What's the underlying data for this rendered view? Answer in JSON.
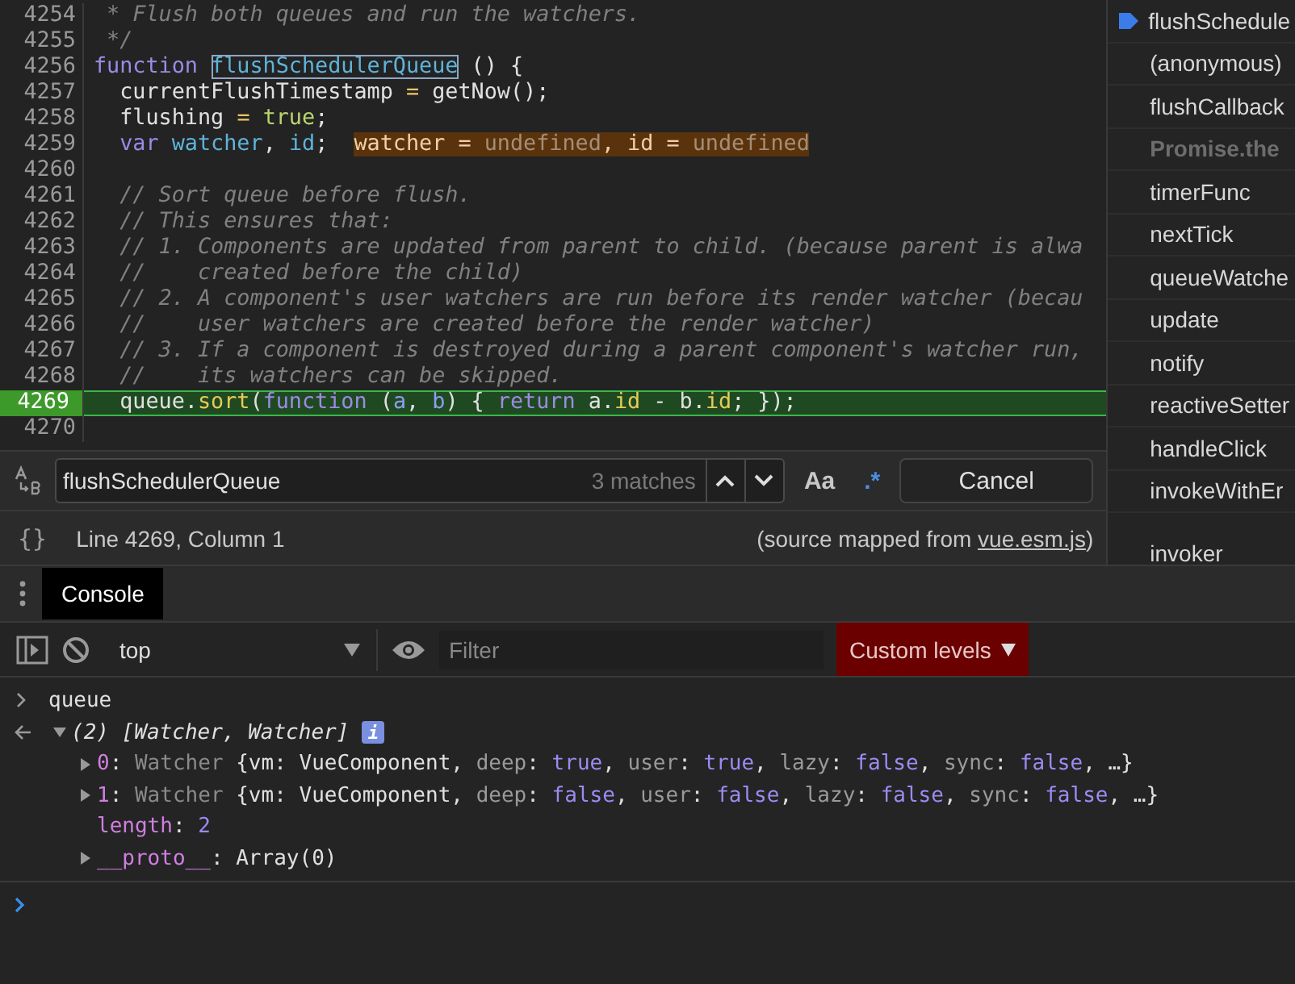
{
  "editor": {
    "lines": [
      {
        "num": "4254",
        "current": false,
        "tokens": [
          {
            "kind": "comment",
            "text": " * Flush both queues and run the watchers."
          }
        ]
      },
      {
        "num": "4255",
        "current": false,
        "tokens": [
          {
            "kind": "comment",
            "text": " */"
          }
        ]
      },
      {
        "num": "4256",
        "current": false,
        "tokens": [
          {
            "kind": "kw",
            "text": "function "
          },
          {
            "kind": "match",
            "text": "flushSchedulerQueue"
          },
          {
            "kind": "plain",
            "text": " () {"
          }
        ]
      },
      {
        "num": "4257",
        "current": false,
        "tokens": [
          {
            "kind": "plain",
            "text": "  currentFlushTimestamp "
          },
          {
            "kind": "op",
            "text": "="
          },
          {
            "kind": "plain",
            "text": " getNow();"
          }
        ]
      },
      {
        "num": "4258",
        "current": false,
        "tokens": [
          {
            "kind": "plain",
            "text": "  flushing "
          },
          {
            "kind": "op",
            "text": "= "
          },
          {
            "kind": "bool",
            "text": "true"
          },
          {
            "kind": "plain",
            "text": ";"
          }
        ]
      },
      {
        "num": "4259",
        "current": false,
        "tokens": [
          {
            "kind": "kw",
            "text": "  var "
          },
          {
            "kind": "var",
            "text": "watcher"
          },
          {
            "kind": "plain",
            "text": ", "
          },
          {
            "kind": "var",
            "text": "id"
          },
          {
            "kind": "plain",
            "text": ";  "
          },
          {
            "kind": "inline_key",
            "text": "watcher = "
          },
          {
            "kind": "inline_val",
            "text": "undefined"
          },
          {
            "kind": "inline_key",
            "text": ", id = "
          },
          {
            "kind": "inline_val",
            "text": "undefined"
          }
        ]
      },
      {
        "num": "4260",
        "current": false
      },
      {
        "num": "4261",
        "current": false,
        "tokens": [
          {
            "kind": "comment",
            "text": "  // Sort queue before flush."
          }
        ]
      },
      {
        "num": "4262",
        "current": false,
        "tokens": [
          {
            "kind": "comment",
            "text": "  // This ensures that:"
          }
        ]
      },
      {
        "num": "4263",
        "current": false,
        "tokens": [
          {
            "kind": "comment",
            "text": "  // 1. Components are updated from parent to child. (because parent is alwa"
          }
        ]
      },
      {
        "num": "4264",
        "current": false,
        "tokens": [
          {
            "kind": "comment",
            "text": "  //    created before the child)"
          }
        ]
      },
      {
        "num": "4265",
        "current": false,
        "tokens": [
          {
            "kind": "comment",
            "text": "  // 2. A component's user watchers are run before its render watcher (becau"
          }
        ]
      },
      {
        "num": "4266",
        "current": false,
        "tokens": [
          {
            "kind": "comment",
            "text": "  //    user watchers are created before the render watcher)"
          }
        ]
      },
      {
        "num": "4267",
        "current": false,
        "tokens": [
          {
            "kind": "comment",
            "text": "  // 3. If a component is destroyed during a parent component's watcher run,"
          }
        ]
      },
      {
        "num": "4268",
        "current": false,
        "tokens": [
          {
            "kind": "comment",
            "text": "  //    its watchers can be skipped."
          }
        ]
      },
      {
        "num": "4269",
        "current": true,
        "tokens": [
          {
            "kind": "plain",
            "text": "  queue."
          },
          {
            "kind": "prop",
            "text": "sort"
          },
          {
            "kind": "plain",
            "text": "("
          },
          {
            "kind": "kw",
            "text": "function"
          },
          {
            "kind": "plain",
            "text": " ("
          },
          {
            "kind": "param",
            "text": "a"
          },
          {
            "kind": "plain",
            "text": ", "
          },
          {
            "kind": "param",
            "text": "b"
          },
          {
            "kind": "plain",
            "text": ") { "
          },
          {
            "kind": "kw",
            "text": "return"
          },
          {
            "kind": "plain",
            "text": " a."
          },
          {
            "kind": "prop",
            "text": "id"
          },
          {
            "kind": "plain",
            "text": " - b."
          },
          {
            "kind": "prop",
            "text": "id"
          },
          {
            "kind": "plain",
            "text": "; });"
          }
        ]
      },
      {
        "num": "4270",
        "current": false
      }
    ]
  },
  "call_stack": [
    {
      "label": "flushSchedule",
      "kind": "frame",
      "selected": true
    },
    {
      "label": "(anonymous)",
      "kind": "frame",
      "selected": false
    },
    {
      "label": "flushCallback",
      "kind": "frame",
      "selected": false
    },
    {
      "label": "Promise.the",
      "kind": "async",
      "selected": false
    },
    {
      "label": "timerFunc",
      "kind": "frame",
      "selected": false
    },
    {
      "label": "nextTick",
      "kind": "frame",
      "selected": false
    },
    {
      "label": "queueWatche",
      "kind": "frame",
      "selected": false
    },
    {
      "label": "update",
      "kind": "frame",
      "selected": false
    },
    {
      "label": "notify",
      "kind": "frame",
      "selected": false
    },
    {
      "label": "reactiveSetter",
      "kind": "frame",
      "selected": false
    },
    {
      "label": "handleClick",
      "kind": "frame",
      "selected": false
    },
    {
      "label": "invokeWithEr",
      "kind": "frame",
      "selected": false
    },
    {
      "label": "invoker",
      "kind": "frame",
      "selected": false
    }
  ],
  "search": {
    "value": "flushSchedulerQueue",
    "matches": "3 matches",
    "case_button": "Aa",
    "regex_button": ".*",
    "cancel": "Cancel"
  },
  "status": {
    "format_glyph": "{}",
    "position": "Line 4269, Column 1",
    "source_prefix": "(source mapped from ",
    "source_link": "vue.esm.js",
    "source_suffix": ")"
  },
  "drawer_tabs": [
    {
      "label": "Console",
      "selected": true
    }
  ],
  "console_toolbar": {
    "context": "top",
    "filter_placeholder": "Filter",
    "levels": "Custom levels"
  },
  "console": [
    {
      "kind": "input",
      "tokens": [
        {
          "kind": "plain",
          "text": "queue"
        }
      ]
    },
    {
      "kind": "result",
      "expanded": true,
      "tokens": [
        {
          "kind": "summary",
          "text": "(2) [Watcher, Watcher]"
        }
      ],
      "badge": "i",
      "children": [
        {
          "expandable": true,
          "tokens": [
            {
              "kind": "key",
              "text": "0"
            },
            {
              "kind": "plain",
              "text": ": "
            },
            {
              "kind": "cls",
              "text": "Watcher"
            },
            {
              "kind": "plain",
              "text": " {vm: VueComponent, "
            },
            {
              "kind": "pkey",
              "text": "deep"
            },
            {
              "kind": "plain",
              "text": ": "
            },
            {
              "kind": "bool",
              "text": "true"
            },
            {
              "kind": "plain",
              "text": ", "
            },
            {
              "kind": "pkey",
              "text": "user"
            },
            {
              "kind": "plain",
              "text": ": "
            },
            {
              "kind": "bool",
              "text": "true"
            },
            {
              "kind": "plain",
              "text": ", "
            },
            {
              "kind": "pkey",
              "text": "lazy"
            },
            {
              "kind": "plain",
              "text": ": "
            },
            {
              "kind": "bool",
              "text": "false"
            },
            {
              "kind": "plain",
              "text": ", "
            },
            {
              "kind": "pkey",
              "text": "sync"
            },
            {
              "kind": "plain",
              "text": ": "
            },
            {
              "kind": "bool",
              "text": "false"
            },
            {
              "kind": "plain",
              "text": ", …}"
            }
          ]
        },
        {
          "expandable": true,
          "tokens": [
            {
              "kind": "key",
              "text": "1"
            },
            {
              "kind": "plain",
              "text": ": "
            },
            {
              "kind": "cls",
              "text": "Watcher"
            },
            {
              "kind": "plain",
              "text": " {vm: VueComponent, "
            },
            {
              "kind": "pkey",
              "text": "deep"
            },
            {
              "kind": "plain",
              "text": ": "
            },
            {
              "kind": "bool",
              "text": "false"
            },
            {
              "kind": "plain",
              "text": ", "
            },
            {
              "kind": "pkey",
              "text": "user"
            },
            {
              "kind": "plain",
              "text": ": "
            },
            {
              "kind": "bool",
              "text": "false"
            },
            {
              "kind": "plain",
              "text": ", "
            },
            {
              "kind": "pkey",
              "text": "lazy"
            },
            {
              "kind": "plain",
              "text": ": "
            },
            {
              "kind": "bool",
              "text": "false"
            },
            {
              "kind": "plain",
              "text": ", "
            },
            {
              "kind": "pkey",
              "text": "sync"
            },
            {
              "kind": "plain",
              "text": ": "
            },
            {
              "kind": "bool",
              "text": "false"
            },
            {
              "kind": "plain",
              "text": ", …}"
            }
          ]
        },
        {
          "expandable": false,
          "tokens": [
            {
              "kind": "key",
              "text": "length"
            },
            {
              "kind": "plain",
              "text": ": "
            },
            {
              "kind": "num",
              "text": "2"
            }
          ]
        },
        {
          "expandable": true,
          "tokens": [
            {
              "kind": "key",
              "text": "__proto__"
            },
            {
              "kind": "plain",
              "text": ": Array(0)"
            }
          ]
        }
      ]
    }
  ]
}
